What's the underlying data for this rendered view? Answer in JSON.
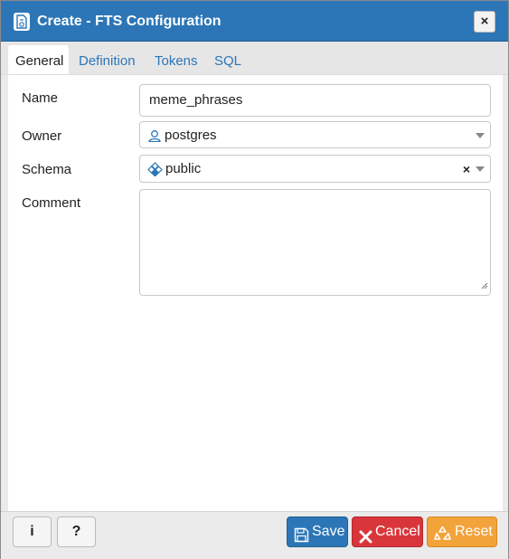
{
  "dialog": {
    "title": "Create - FTS Configuration",
    "close_label": "×"
  },
  "tabs": [
    {
      "label": "General",
      "active": true
    },
    {
      "label": "Definition",
      "active": false
    },
    {
      "label": "Tokens",
      "active": false
    },
    {
      "label": "SQL",
      "active": false
    }
  ],
  "form": {
    "name": {
      "label": "Name",
      "value": "meme_phrases"
    },
    "owner": {
      "label": "Owner",
      "value": "postgres",
      "icon": "user-icon"
    },
    "schema": {
      "label": "Schema",
      "value": "public",
      "icon": "schema-icon",
      "clear": "×"
    },
    "comment": {
      "label": "Comment",
      "value": ""
    }
  },
  "footer": {
    "info_label": "i",
    "help_label": "?",
    "save_label": "Save",
    "cancel_label": "Cancel",
    "reset_label": "Reset"
  },
  "colors": {
    "titlebar": "#2c76b7",
    "save": "#2c76b7",
    "cancel": "#d9363b",
    "reset": "#f2a33a"
  }
}
